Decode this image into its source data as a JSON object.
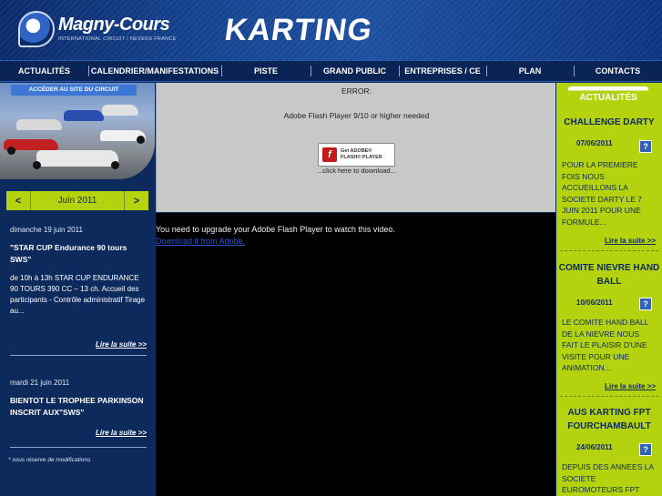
{
  "header": {
    "logo_text": "Magny-Cours",
    "logo_sub": "INTERNATIONAL CIRCUIT / NEVERS FRANCE",
    "title": "KARTING"
  },
  "nav": {
    "items": [
      {
        "label": "ACTUALITÉS"
      },
      {
        "label": "CALENDRIER/MANIFESTATIONS"
      },
      {
        "label": "PISTE"
      },
      {
        "label": "GRAND PUBLIC"
      },
      {
        "label": "ENTREPRISES / CE"
      },
      {
        "label": "PLAN"
      },
      {
        "label": "CONTACTS"
      }
    ]
  },
  "sidebar": {
    "promo_label": "ACCÉDER AU SITE DU CIRCUIT",
    "month": {
      "prev": "<",
      "label": "Juin 2011",
      "next": ">"
    },
    "events": [
      {
        "date": "dimanche 19 juin 2011",
        "title": "\"STAR CUP Endurance 90 tours SWS\"",
        "desc": "de 10h à 13h STAR CUP ENDURANCE 90 TOURS 390 CC – 13 ch. Accueil des participants - Contrôle administratif Tirage au...",
        "more": "Lire la suite >>"
      },
      {
        "date": "mardi 21 juin 2011",
        "title": "BIENTOT LE TROPHEE PARKINSON INSCRIT AUX\"SWS\"",
        "desc": "",
        "more": "Lire la suite >>"
      }
    ],
    "footnote": "* sous réserve de modifications"
  },
  "main": {
    "error_title": "ERROR:",
    "error_msg": "Adobe Flash Player 9/10 or higher needed",
    "flash_button": {
      "line1": "Get ADOBE®",
      "line2": "FLASH® PLAYER"
    },
    "flash_download": "...click here to download...",
    "upgrade_text": "You need to upgrade your Adobe Flash Player to watch this video.",
    "download_link": "Download it from Adobe."
  },
  "news": {
    "tab_label": "ACTUALITÉS",
    "items": [
      {
        "title": "CHALLENGE DARTY",
        "date": "07/06/2011",
        "text": "POUR LA PREMIERE FOIS NOUS ACCUEILLONS LA SOCIETE DARTY LE 7 JUIN 2011 POUR UNE FORMULE...",
        "more": "Lire la suite >>"
      },
      {
        "title": "COMITE NIEVRE HAND BALL",
        "date": "10/06/2011",
        "text": "LE COMITE HAND BALL DE LA NIEVRE NOUS FAIT LE PLAISIR D'UNE VISITE POUR UNE ANIMATION...",
        "more": "Lire la suite >>"
      },
      {
        "title": "AUS KARTING FPT FOURCHAMBAULT",
        "date": "24/06/2011",
        "text": "DEPUIS DES ANNEES LA SOCIETE EUROMOTEURS FPT",
        "more": ""
      }
    ],
    "info_icon": "?"
  },
  "colors": {
    "navy": "#0d2a5c",
    "lime": "#b5d20f",
    "grey": "#c8c8c8"
  }
}
